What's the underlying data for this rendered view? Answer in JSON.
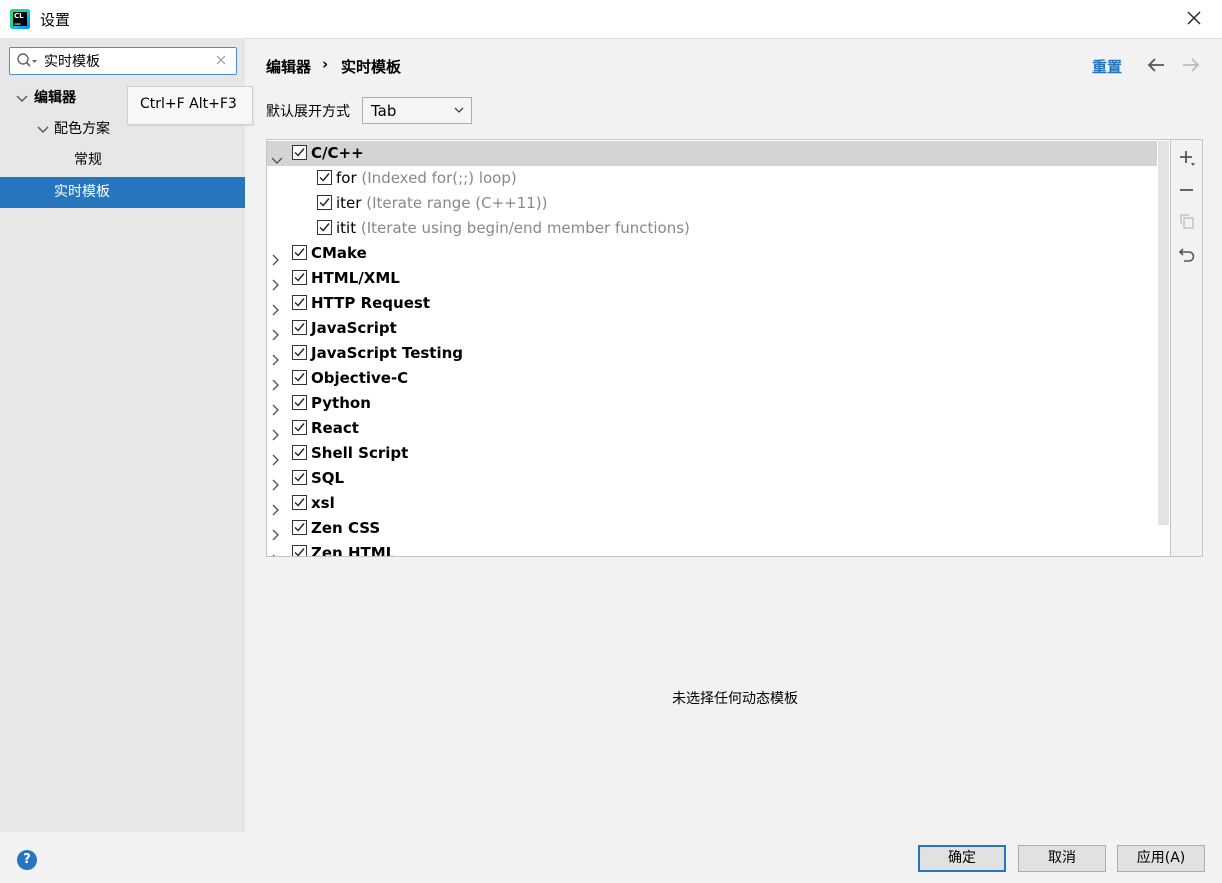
{
  "window": {
    "title": "设置"
  },
  "search": {
    "value": "实时模板"
  },
  "tooltip": {
    "text": "Ctrl+F Alt+F3"
  },
  "sidebar": {
    "items": [
      {
        "label": "编辑器"
      },
      {
        "label": "配色方案"
      },
      {
        "label": "常规"
      },
      {
        "label": "实时模板"
      }
    ]
  },
  "header": {
    "breadcrumb": [
      "编辑器",
      "实时模板"
    ],
    "reset_label": "重置"
  },
  "expand_with": {
    "label": "默认展开方式",
    "value": "Tab"
  },
  "template_groups": [
    {
      "name": "C/C++",
      "checked": true,
      "expanded": true,
      "templates": [
        {
          "name": "for",
          "description": "(Indexed for(;;) loop)",
          "checked": true
        },
        {
          "name": "iter",
          "description": "(Iterate range (C++11))",
          "checked": true
        },
        {
          "name": "itit",
          "description": "(Iterate using begin/end member functions)",
          "checked": true
        }
      ]
    },
    {
      "name": "CMake",
      "checked": true
    },
    {
      "name": "HTML/XML",
      "checked": true
    },
    {
      "name": "HTTP Request",
      "checked": true
    },
    {
      "name": "JavaScript",
      "checked": true
    },
    {
      "name": "JavaScript Testing",
      "checked": true
    },
    {
      "name": "Objective-C",
      "checked": true
    },
    {
      "name": "Python",
      "checked": true
    },
    {
      "name": "React",
      "checked": true
    },
    {
      "name": "Shell Script",
      "checked": true
    },
    {
      "name": "SQL",
      "checked": true
    },
    {
      "name": "xsl",
      "checked": true
    },
    {
      "name": "Zen CSS",
      "checked": true
    },
    {
      "name": "Zen HTML",
      "checked": true
    }
  ],
  "empty_message": "未选择任何动态模板",
  "footer": {
    "help_label": "?",
    "ok_label": "确定",
    "cancel_label": "取消",
    "apply_label": "应用(A)"
  },
  "colors": {
    "accent": "#2675bf",
    "selection": "#2675bf",
    "row_highlight": "#d4d4d4"
  }
}
